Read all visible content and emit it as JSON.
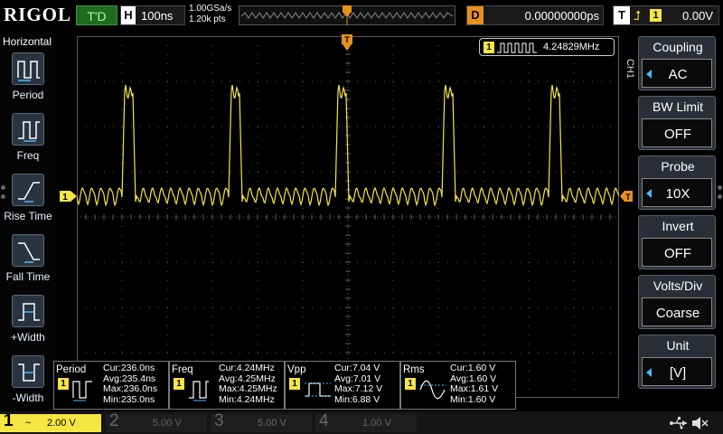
{
  "brand": "RIGOL",
  "run_state": "T'D",
  "horizontal": {
    "key": "H",
    "timebase": "100ns",
    "sample_rate": "1.00GSa/s",
    "memory": "1.20k pts"
  },
  "delay": {
    "key": "D",
    "value": "0.00000000ps"
  },
  "trigger": {
    "key": "T",
    "channel": "1",
    "level": "0.00V"
  },
  "left_menu": {
    "title": "Horizontal",
    "items": [
      {
        "label": "Period",
        "icon": "period-icon"
      },
      {
        "label": "Freq",
        "icon": "frequency-icon"
      },
      {
        "label": "Rise Time",
        "icon": "rise-time-icon"
      },
      {
        "label": "Fall Time",
        "icon": "fall-time-icon"
      },
      {
        "label": "+Width",
        "icon": "positive-width-icon"
      },
      {
        "label": "-Width",
        "icon": "negative-width-icon"
      }
    ]
  },
  "counter": {
    "channel": "1",
    "value": "4.24829MHz"
  },
  "right_menu": {
    "channel_label": "CH1",
    "items": [
      {
        "title": "Coupling",
        "value": "AC",
        "has_arrow": true
      },
      {
        "title": "BW Limit",
        "value": "OFF",
        "has_arrow": false
      },
      {
        "title": "Probe",
        "value": "10X",
        "has_arrow": true
      },
      {
        "title": "Invert",
        "value": "OFF",
        "has_arrow": false
      },
      {
        "title": "Volts/Div",
        "value": "Coarse",
        "has_arrow": false
      },
      {
        "title": "Unit",
        "value": "[V]",
        "has_arrow": true
      }
    ]
  },
  "markers": {
    "ch1_level": "1",
    "trigger_pos": "T",
    "trigger_right": "T"
  },
  "measurements": [
    {
      "name": "Period",
      "cur": "Cur:236.0ns",
      "avg": "Avg:235.4ns",
      "max": "Max:236.0ns",
      "min": "Min:235.0ns",
      "icon": "period-measure-icon"
    },
    {
      "name": "Freq",
      "cur": "Cur:4.24MHz",
      "avg": "Avg:4.25MHz",
      "max": "Max:4.25MHz",
      "min": "Min:4.24MHz",
      "icon": "frequency-measure-icon"
    },
    {
      "name": "Vpp",
      "cur": "Cur:7.04 V",
      "avg": "Avg:7.01 V",
      "max": "Max:7.12 V",
      "min": "Min:6.88 V",
      "icon": "vpp-measure-icon"
    },
    {
      "name": "Rms",
      "cur": "Cur:1.60 V",
      "avg": "Avg:1.60 V",
      "max": "Max:1.61 V",
      "min": "Min:1.60 V",
      "icon": "rms-measure-icon"
    }
  ],
  "channels": [
    {
      "num": "1",
      "coupling": "~",
      "scale": "2.00 V"
    },
    {
      "num": "2",
      "scale": "5.00 V"
    },
    {
      "num": "3",
      "scale": "5.00 V"
    },
    {
      "num": "4",
      "scale": "1.00 V"
    }
  ],
  "colors": {
    "ch1": "#f5e642",
    "trigger": "#e8901c",
    "grid": "#5a5a5a",
    "menu_bg": "#2a2f37",
    "accent_blue": "#4ab8ff"
  },
  "status_icons": [
    "usb-icon",
    "speaker-muted-icon"
  ]
}
